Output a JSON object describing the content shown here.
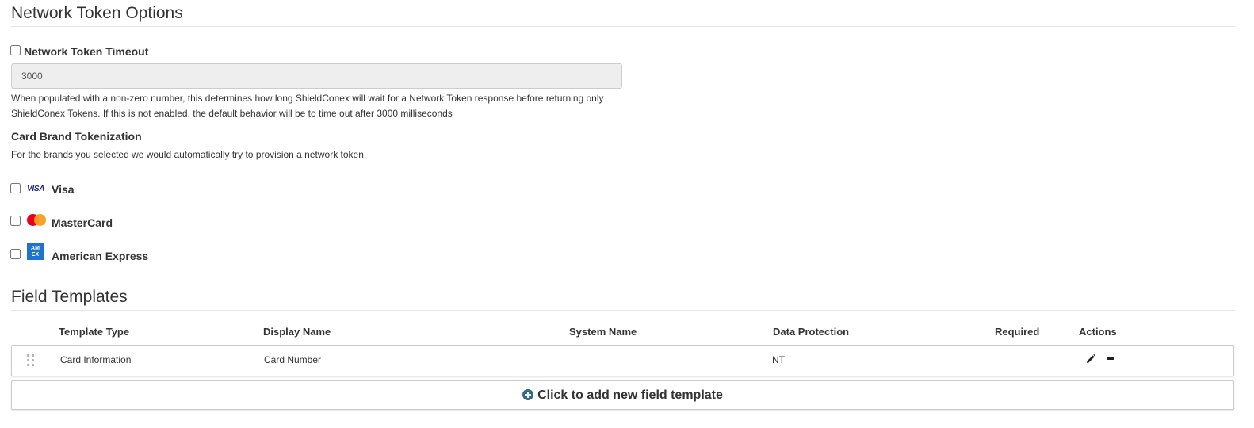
{
  "network_token_options": {
    "title": "Network Token Options",
    "timeout": {
      "label": "Network Token Timeout",
      "checked": false,
      "value": "3000",
      "help_line1": "When populated with a non-zero number, this determines how long ShieldConex will wait for a Network Token response before returning only",
      "help_line2": "ShieldConex Tokens. If this is not enabled, the default behavior will be to time out after 3000 milliseconds"
    },
    "card_brand": {
      "heading": "Card Brand Tokenization",
      "description": "For the brands you selected we would automatically try to provision a network token.",
      "brands": [
        {
          "label": "Visa",
          "icon": "visa-icon",
          "checked": false
        },
        {
          "label": "MasterCard",
          "icon": "mastercard-icon",
          "checked": false
        },
        {
          "label": "American Express",
          "icon": "amex-icon",
          "checked": false
        }
      ],
      "visa_mark": "VISA",
      "amex_mark_top": "AM",
      "amex_mark_bottom": "EX"
    }
  },
  "field_templates": {
    "title": "Field Templates",
    "columns": [
      "Template Type",
      "Display Name",
      "System Name",
      "Data Protection",
      "Required",
      "Actions"
    ],
    "rows": [
      {
        "template_type": "Card Information",
        "display_name": "Card Number",
        "system_name": "",
        "data_protection": "NT",
        "required": ""
      }
    ],
    "add_label": "Click to add new field template"
  },
  "colors": {
    "accent": "#2e6c8a",
    "input_bg": "#eeeeee",
    "border": "#cccccc"
  }
}
